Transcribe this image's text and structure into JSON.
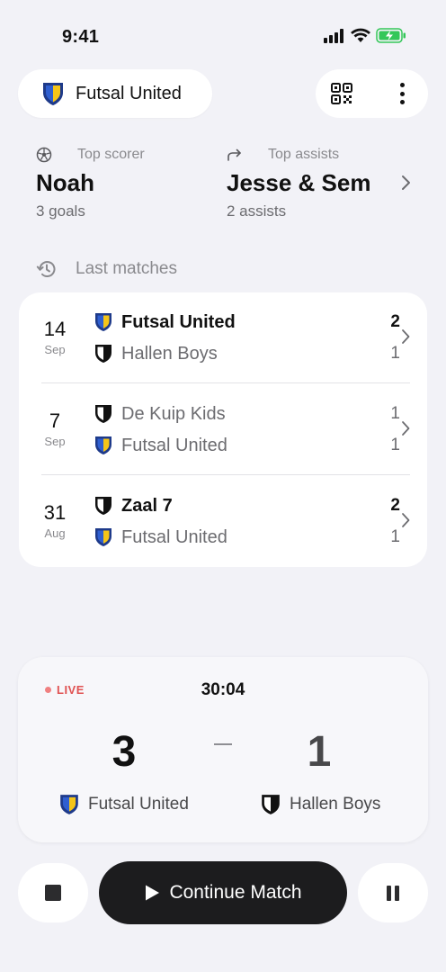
{
  "status_bar": {
    "time": "9:41",
    "battery_color": "#34c759"
  },
  "header": {
    "team_name": "Futsal United",
    "team_icon": "shield-blue-yellow-icon",
    "actions": [
      "qr-code-icon",
      "more-vertical-icon"
    ]
  },
  "stats": {
    "top_scorer": {
      "label": "Top scorer",
      "name": "Noah",
      "detail": "3 goals",
      "icon": "soccer-ball-icon"
    },
    "top_assists": {
      "label": "Top assists",
      "name": "Jesse & Sem",
      "detail": "2 assists",
      "icon": "forward-arrow-icon"
    }
  },
  "last_matches": {
    "title": "Last matches",
    "icon": "history-icon",
    "items": [
      {
        "day": "14",
        "month": "Sep",
        "team1": {
          "name": "Futsal United",
          "score": "2",
          "crest": "blue-yellow",
          "winner": true
        },
        "team2": {
          "name": "Hallen Boys",
          "score": "1",
          "crest": "black-white",
          "winner": false
        }
      },
      {
        "day": "7",
        "month": "Sep",
        "team1": {
          "name": "De Kuip Kids",
          "score": "1",
          "crest": "black-white",
          "winner": false
        },
        "team2": {
          "name": "Futsal United",
          "score": "1",
          "crest": "blue-yellow",
          "winner": false
        }
      },
      {
        "day": "31",
        "month": "Aug",
        "team1": {
          "name": "Zaal 7",
          "score": "2",
          "crest": "black-white",
          "winner": true
        },
        "team2": {
          "name": "Futsal United",
          "score": "1",
          "crest": "blue-yellow",
          "winner": false
        }
      }
    ]
  },
  "live_match": {
    "badge": "LIVE",
    "clock": "30:04",
    "home": {
      "name": "Futsal United",
      "score": "3"
    },
    "away": {
      "name": "Hallen Boys",
      "score": "1"
    }
  },
  "controls": {
    "stop_icon": "stop-icon",
    "continue_label": "Continue Match",
    "pause_icon": "pause-icon"
  },
  "colors": {
    "background": "#f2f2f7",
    "crest_blue": "#2f5fd0",
    "crest_yellow": "#f5c518",
    "live_red": "#e05252",
    "primary_button": "#1c1c1e"
  }
}
